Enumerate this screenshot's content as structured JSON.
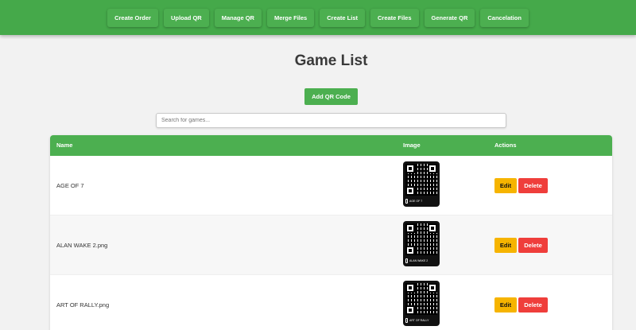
{
  "nav": {
    "items": [
      "Create Order",
      "Upload QR",
      "Manage QR",
      "Merge Files",
      "Create List",
      "Create Files",
      "Generate QR",
      "Cancelation"
    ]
  },
  "page": {
    "title": "Game List"
  },
  "toolbar": {
    "add_label": "Add QR Code"
  },
  "search": {
    "placeholder": "Search for games..."
  },
  "table": {
    "headers": {
      "name": "Name",
      "image": "Image",
      "actions": "Actions"
    },
    "rows": [
      {
        "name": "AGE OF 7",
        "qr_label": "AGE OF 7",
        "edit": "Edit",
        "delete": "Delete"
      },
      {
        "name": "ALAN WAKE 2.png",
        "qr_label": "ALAN WAKE 2",
        "edit": "Edit",
        "delete": "Delete"
      },
      {
        "name": "ART OF RALLY.png",
        "qr_label": "ART OF RALLY",
        "edit": "Edit",
        "delete": "Delete"
      }
    ]
  },
  "colors": {
    "brand_green": "#4caf50",
    "edit_yellow": "#f6b400",
    "delete_red": "#ef3e3b"
  }
}
